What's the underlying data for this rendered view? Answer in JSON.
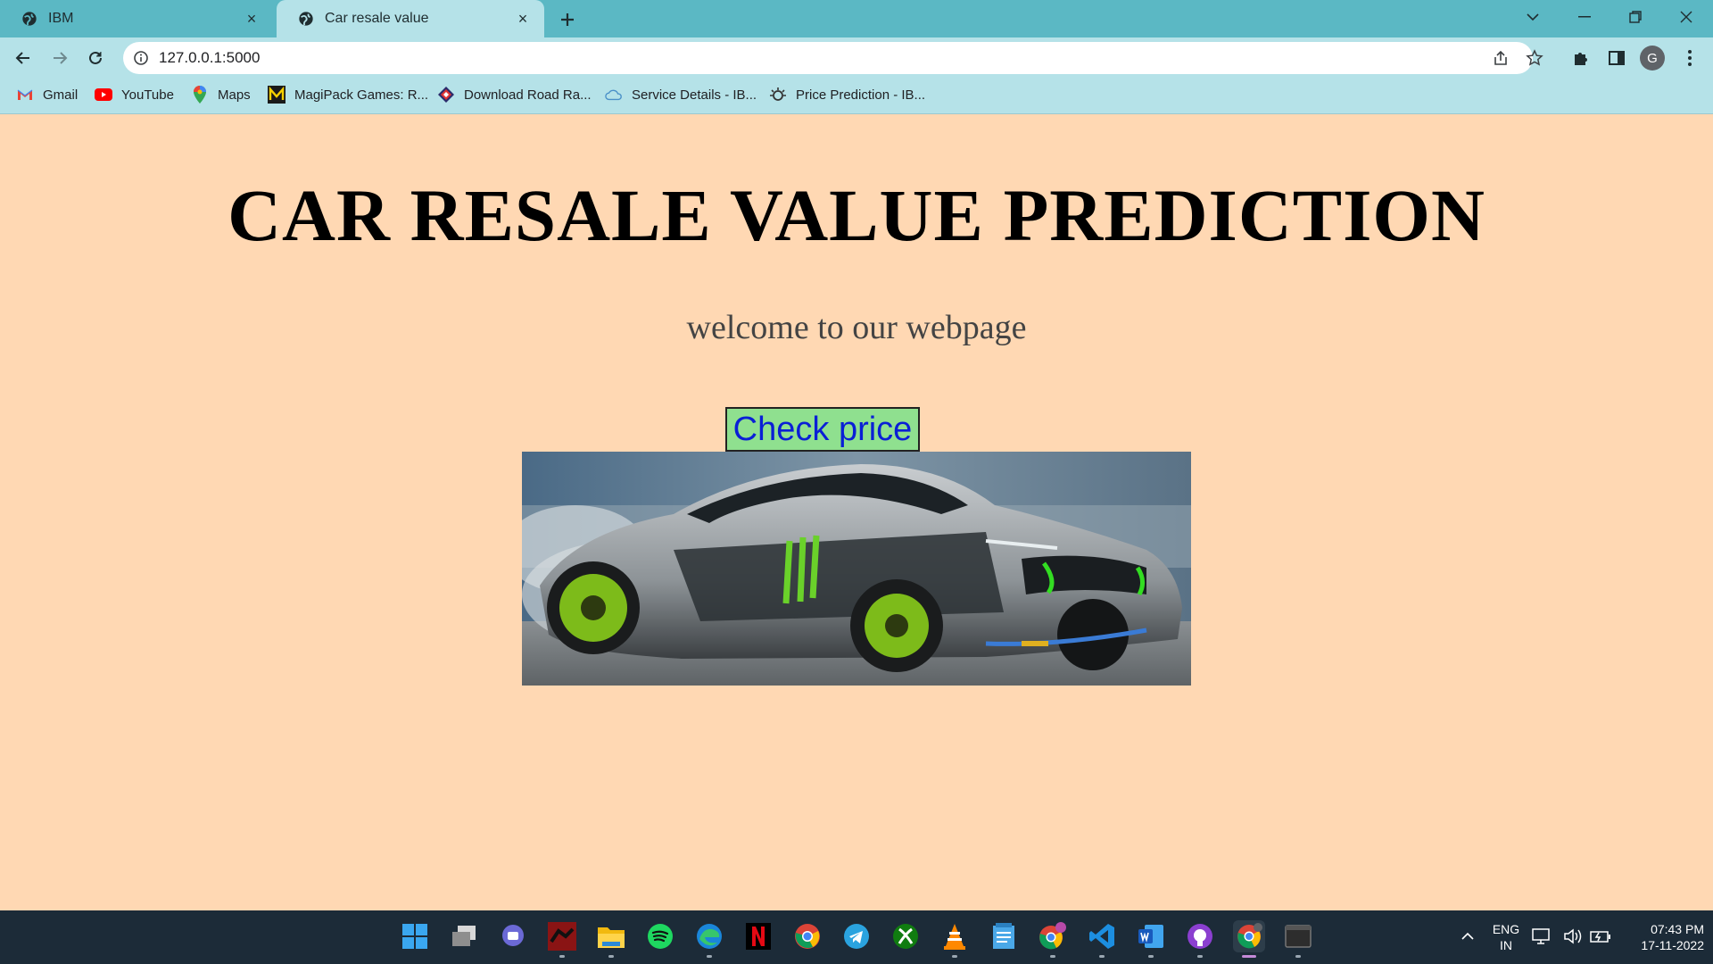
{
  "tabs": [
    {
      "title": "IBM",
      "icon": "globe-icon",
      "close": "×"
    },
    {
      "title": "Car resale value",
      "icon": "globe-icon",
      "close": "×"
    }
  ],
  "new_tab": "+",
  "address_bar": {
    "url": "127.0.0.1:5000"
  },
  "profile_initial": "G",
  "bookmarks": [
    {
      "label": "Gmail",
      "icon": "gmail-icon"
    },
    {
      "label": "YouTube",
      "icon": "youtube-icon"
    },
    {
      "label": "Maps",
      "icon": "maps-icon"
    },
    {
      "label": "MagiPack Games: R...",
      "icon": "magipack-icon"
    },
    {
      "label": "Download Road Ra...",
      "icon": "road-rash-icon"
    },
    {
      "label": "Service Details - IB...",
      "icon": "cloud-icon"
    },
    {
      "label": "Price Prediction - IB...",
      "icon": "gear-icon"
    }
  ],
  "page": {
    "title": "CAR RESALE VALUE PREDICTION",
    "subtitle": "welcome to our webpage",
    "button_label": "Check price",
    "background": "#ffd8b3",
    "button_color": "#8fe08f",
    "button_text_color": "#0a1fd6"
  },
  "taskbar": {
    "apps": [
      "windows-start-icon",
      "task-view-icon",
      "teams-chat-icon",
      "game-icon",
      "file-explorer-icon",
      "spotify-icon",
      "edge-icon",
      "netflix-icon",
      "chrome-icon",
      "telegram-icon",
      "xbox-icon",
      "vlc-icon",
      "notepad-icon",
      "chrome-profile-icon",
      "vscode-icon",
      "word-icon",
      "github-icon",
      "chrome-active-icon",
      "terminal-icon"
    ],
    "language": "ENG",
    "region": "IN",
    "time": "07:43 PM",
    "date": "17-11-2022"
  }
}
